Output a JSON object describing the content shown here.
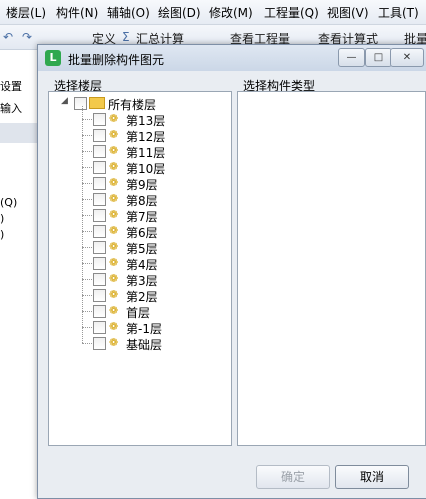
{
  "background": {
    "menu": [
      "楼层(L)",
      "构件(N)",
      "辅轴(O)",
      "绘图(D)",
      "修改(M)",
      "工程量(Q)",
      "视图(V)",
      "工具(T)"
    ],
    "toolbar": {
      "define_label": "定义",
      "sum_label": "汇总计算",
      "view_quantity_label": "查看工程量",
      "view_formula_label": "查看计算式",
      "batch_label": "批量"
    },
    "left_panel": {
      "settings_label": "设置",
      "input_label": "输入",
      "q_label": "(Q)",
      "paren1": ")",
      "paren2": ")"
    }
  },
  "dialog": {
    "title": "批量删除构件图元",
    "left_pane_label": "选择楼层",
    "right_pane_label": "选择构件类型",
    "tree": {
      "root": "所有楼层",
      "floors": [
        "第13层",
        "第12层",
        "第11层",
        "第10层",
        "第9层",
        "第8层",
        "第7层",
        "第6层",
        "第5层",
        "第4层",
        "第3层",
        "第2层",
        "首层",
        "第-1层",
        "基础层"
      ]
    },
    "ok_label": "确定",
    "cancel_label": "取消",
    "window_buttons": {
      "minimize": "—",
      "maximize": "□",
      "close": "✕"
    }
  }
}
